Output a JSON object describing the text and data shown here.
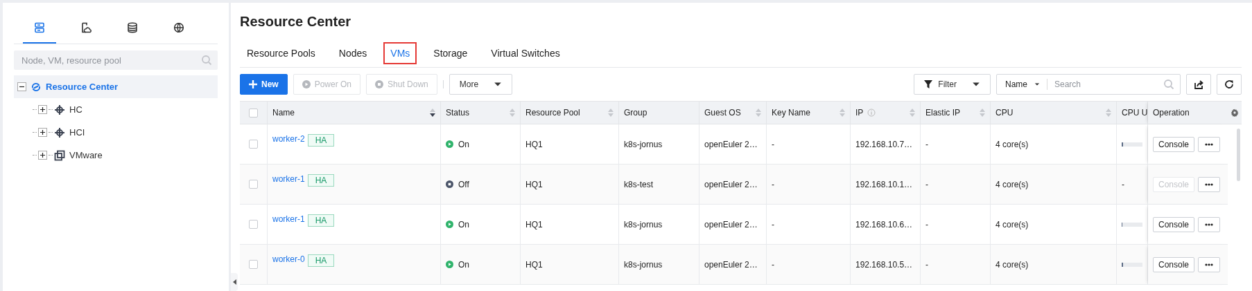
{
  "sidebar": {
    "tabs": [
      {
        "kind": "server",
        "selected": true
      },
      {
        "kind": "cloud-doc",
        "selected": false
      },
      {
        "kind": "database",
        "selected": false
      },
      {
        "kind": "globe",
        "selected": false
      }
    ],
    "search": {
      "placeholder": "Node, VM, resource pool"
    },
    "tree": [
      {
        "label": "Resource Center",
        "kind": "root",
        "expanded": true,
        "selected": true,
        "children": [
          {
            "label": "HC",
            "kind": "cluster",
            "expanded": false,
            "selected": false
          },
          {
            "label": "HCI",
            "kind": "cluster",
            "expanded": false,
            "selected": false
          },
          {
            "label": "VMware",
            "kind": "vmware",
            "expanded": false,
            "selected": false
          }
        ]
      }
    ]
  },
  "page": {
    "title": "Resource Center"
  },
  "tabs": [
    {
      "label": "Resource Pools",
      "selected": false
    },
    {
      "label": "Nodes",
      "selected": false
    },
    {
      "label": "VMs",
      "selected": true
    },
    {
      "label": "Storage",
      "selected": false
    },
    {
      "label": "Virtual Switches",
      "selected": false
    }
  ],
  "toolbar": {
    "buttons": [
      {
        "label": "New",
        "kind": "primary",
        "disabled": false
      },
      {
        "label": "Power On",
        "kind": "play",
        "disabled": true
      },
      {
        "label": "Shut Down",
        "kind": "stop",
        "disabled": true
      },
      {
        "label": "More",
        "kind": "dropdown",
        "disabled": false
      }
    ],
    "filter": {
      "label": "Filter"
    },
    "search": {
      "field": "Name",
      "placeholder": "Search"
    }
  },
  "table": {
    "columns": [
      {
        "label": "Name",
        "sortable": true,
        "sorted_descending": true,
        "info": false
      },
      {
        "label": "Status",
        "sortable": true,
        "sorted_descending": false,
        "info": false
      },
      {
        "label": "Resource Pool",
        "sortable": true,
        "sorted_descending": false,
        "info": false
      },
      {
        "label": "Group",
        "sortable": false,
        "info": false
      },
      {
        "label": "Guest OS",
        "sortable": true,
        "sorted_descending": false,
        "info": false
      },
      {
        "label": "Key Name",
        "sortable": true,
        "sorted_descending": false,
        "info": false
      },
      {
        "label": "IP",
        "sortable": true,
        "sorted_descending": false,
        "info": true
      },
      {
        "label": "Elastic IP",
        "sortable": true,
        "sorted_descending": false,
        "info": false
      },
      {
        "label": "CPU",
        "sortable": true,
        "sorted_descending": false,
        "info": false
      },
      {
        "label": "CPU U"
      },
      {
        "label": "Operation",
        "sortable": false,
        "info": false
      }
    ],
    "rows": [
      {
        "checked": false,
        "name": "worker-2",
        "tag": "HA",
        "status": {
          "label": "On",
          "kind": "on"
        },
        "pool": "HQ1",
        "group": "k8s-jornus",
        "os": "openEuler 2…",
        "key": "-",
        "ip": "192.168.10.7…",
        "eip": "-",
        "cpu": "4 core(s)",
        "cpu_usage": {
          "level": 0.06
        },
        "console": {
          "label": "Console",
          "disabled": false
        }
      },
      {
        "checked": false,
        "name": "worker-1",
        "tag": "HA",
        "status": {
          "label": "Off",
          "kind": "off"
        },
        "pool": "HQ1",
        "group": "k8s-test",
        "os": "openEuler 2…",
        "key": "-",
        "ip": "192.168.10.1…",
        "eip": "-",
        "cpu": "4 core(s)",
        "cpu_usage": {
          "text": "-"
        },
        "console": {
          "label": "Console",
          "disabled": true
        }
      },
      {
        "checked": false,
        "name": "worker-1",
        "tag": "HA",
        "status": {
          "label": "On",
          "kind": "on"
        },
        "pool": "HQ1",
        "group": "k8s-jornus",
        "os": "openEuler 2…",
        "key": "-",
        "ip": "192.168.10.6…",
        "eip": "-",
        "cpu": "4 core(s)",
        "cpu_usage": {
          "level": 0.04
        },
        "console": {
          "label": "Console",
          "disabled": false
        }
      },
      {
        "checked": false,
        "name": "worker-0",
        "tag": "HA",
        "status": {
          "label": "On",
          "kind": "on"
        },
        "pool": "HQ1",
        "group": "k8s-jornus",
        "os": "openEuler 2…",
        "key": "-",
        "ip": "192.168.10.5…",
        "eip": "-",
        "cpu": "4 core(s)",
        "cpu_usage": {
          "level": 0.06
        },
        "console": {
          "label": "Console",
          "disabled": false
        }
      }
    ],
    "header_checked": false
  }
}
